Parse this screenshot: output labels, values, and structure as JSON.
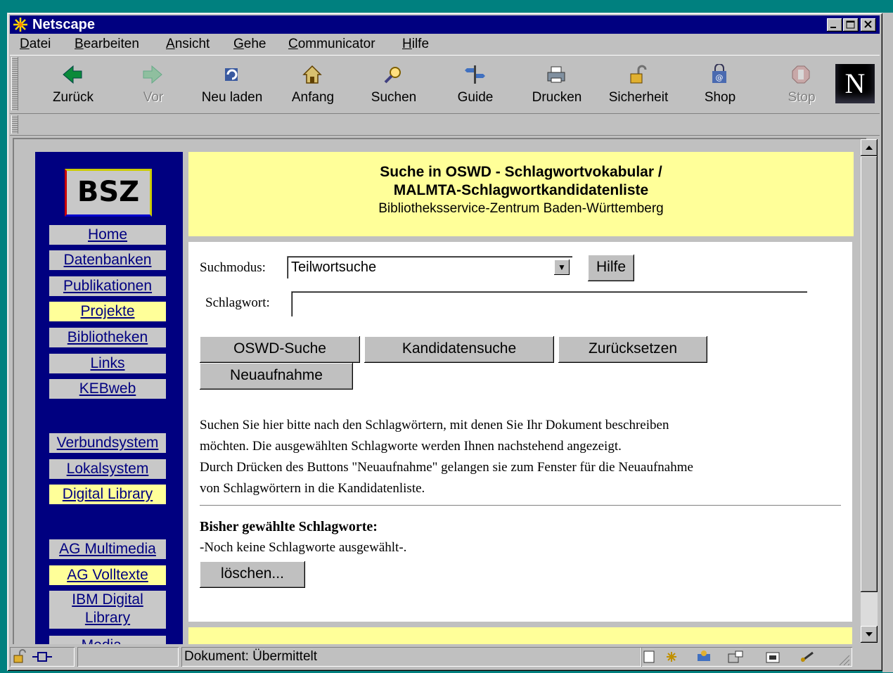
{
  "window": {
    "title": "Netscape"
  },
  "menu": [
    "Datei",
    "Bearbeiten",
    "Ansicht",
    "Gehe",
    "Communicator",
    "Hilfe"
  ],
  "toolbar": [
    {
      "label": "Zurück",
      "icon": "back-arrow-icon",
      "enabled": true
    },
    {
      "label": "Vor",
      "icon": "forward-arrow-icon",
      "enabled": false
    },
    {
      "label": "Neu laden",
      "icon": "reload-icon",
      "enabled": true
    },
    {
      "label": "Anfang",
      "icon": "home-icon",
      "enabled": true
    },
    {
      "label": "Suchen",
      "icon": "search-icon",
      "enabled": true
    },
    {
      "label": "Guide",
      "icon": "guide-icon",
      "enabled": true
    },
    {
      "label": "Drucken",
      "icon": "print-icon",
      "enabled": true
    },
    {
      "label": "Sicherheit",
      "icon": "lock-icon",
      "enabled": true
    },
    {
      "label": "Shop",
      "icon": "shop-icon",
      "enabled": true
    },
    {
      "label": "Stop",
      "icon": "stop-icon",
      "enabled": false
    }
  ],
  "logo": {
    "text": "N"
  },
  "sidebar": {
    "logo_text": "BSZ",
    "items": [
      "Home",
      "Datenbanken",
      "Publikationen",
      "Projekte",
      "Bibliotheken",
      "Links",
      "KEBweb",
      "Verbundsystem",
      "Lokalsystem",
      "Digital Library",
      "AG Multimedia",
      "AG Volltexte",
      "IBM Digital Library",
      "Media..."
    ]
  },
  "banner": {
    "title_line1": "Suche in OSWD - Schlagwortvokabular /",
    "title_line2": "MALMTA-Schlagwortkandidatenliste",
    "subtitle": "Bibliotheksservice-Zentrum Baden-Württemberg"
  },
  "form": {
    "mode_label": "Suchmodus:",
    "mode_value": "Teilwortsuche",
    "help_button": "Hilfe",
    "keyword_label": "Schlagwort:",
    "keyword_value": "",
    "buttons": [
      "OSWD-Suche",
      "Kandidatensuche",
      "Zurücksetzen",
      "Neuaufnahme"
    ]
  },
  "instructions": [
    "Suchen Sie hier bitte nach den Schlagwörtern, mit denen Sie Ihr Dokument beschreiben",
    "möchten. Die ausgewählten Schlagworte werden Ihnen nachstehend angezeigt.",
    "Durch Drücken des Buttons \"Neuaufnahme\" gelangen sie zum Fenster für die Neuaufnahme",
    "von Schlagwörtern in die Kandidatenliste."
  ],
  "selected": {
    "heading": "Bisher gewählte Schlagworte:",
    "empty_text": "-Noch keine Schlagworte ausgewählt-.",
    "delete_button": "löschen..."
  },
  "status": {
    "text": "Dokument: Übermittelt"
  },
  "colors": {
    "titlebar": "#000080",
    "sidebar": "#000080",
    "banner": "#ffff99",
    "desktop": "#00807f"
  }
}
